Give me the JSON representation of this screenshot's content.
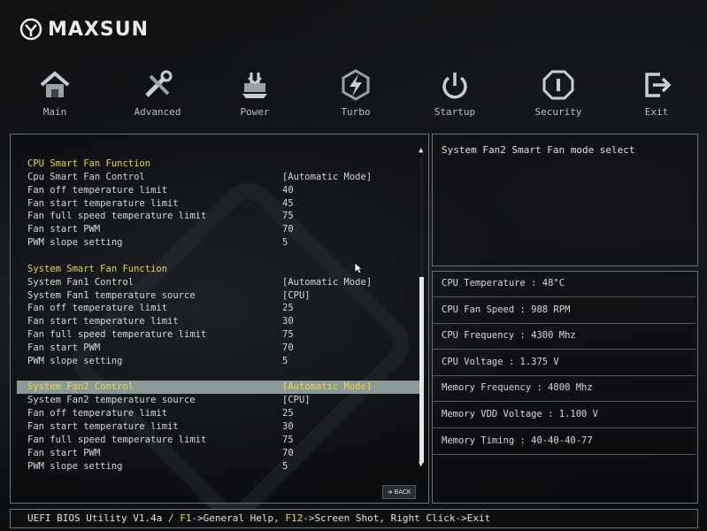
{
  "brand": "MAXSUN",
  "nav": [
    {
      "label": "Main",
      "icon": "home-icon"
    },
    {
      "label": "Advanced",
      "icon": "tools-icon"
    },
    {
      "label": "Power",
      "icon": "power-chip-icon"
    },
    {
      "label": "Turbo",
      "icon": "lightning-icon"
    },
    {
      "label": "Startup",
      "icon": "power-button-icon"
    },
    {
      "label": "Security",
      "icon": "security-icon"
    },
    {
      "label": "Exit",
      "icon": "exit-icon"
    }
  ],
  "settings": [
    {
      "label": "CPU Smart Fan Function",
      "value": "",
      "section": true
    },
    {
      "label": "Cpu Smart Fan Control",
      "value": "[Automatic Mode]"
    },
    {
      "label": "Fan off temperature limit",
      "value": "40"
    },
    {
      "label": "Fan start temperature limit",
      "value": "45"
    },
    {
      "label": "Fan full speed temperature limit",
      "value": "75"
    },
    {
      "label": "Fan start PWM",
      "value": "70"
    },
    {
      "label": "PWM slope setting",
      "value": "5"
    },
    {
      "label": "",
      "value": ""
    },
    {
      "label": "System Smart Fan Function",
      "value": "",
      "section": true
    },
    {
      "label": "System Fan1 Control",
      "value": "[Automatic Mode]"
    },
    {
      "label": "System Fan1 temperature source",
      "value": "[CPU]"
    },
    {
      "label": "Fan off temperature limit",
      "value": "25"
    },
    {
      "label": "Fan start temperature limit",
      "value": "30"
    },
    {
      "label": "Fan full speed temperature limit",
      "value": "75"
    },
    {
      "label": "Fan start PWM",
      "value": "70"
    },
    {
      "label": "PWM slope setting",
      "value": "5"
    },
    {
      "label": "",
      "value": ""
    },
    {
      "label": "System Fan2 Control",
      "value": "[Automatic Mode]",
      "selected": true
    },
    {
      "label": "System Fan2 temperature source",
      "value": "[CPU]"
    },
    {
      "label": "Fan off temperature limit",
      "value": "25"
    },
    {
      "label": "Fan start temperature limit",
      "value": "30"
    },
    {
      "label": "Fan full speed temperature limit",
      "value": "75"
    },
    {
      "label": "Fan start PWM",
      "value": "70"
    },
    {
      "label": "PWM slope setting",
      "value": "5"
    }
  ],
  "help": "System Fan2 Smart Fan mode select",
  "back_label": "BACK",
  "info": [
    "CPU Temperature : 48°C",
    "CPU Fan Speed : 988 RPM",
    "CPU Frequency : 4300 Mhz",
    "CPU Voltage : 1.375 V",
    "Memory Frequency : 4800 Mhz",
    "Memory VDD Voltage : 1.100 V",
    "Memory Timing : 40-40-40-77"
  ],
  "status": {
    "prefix": "UEFI BIOS Utility V1.4a / ",
    "f1": "F1",
    "f1_text": "->General Help, ",
    "f12": "F12",
    "f12_text": "->Screen Shot, Right Click->Exit"
  }
}
